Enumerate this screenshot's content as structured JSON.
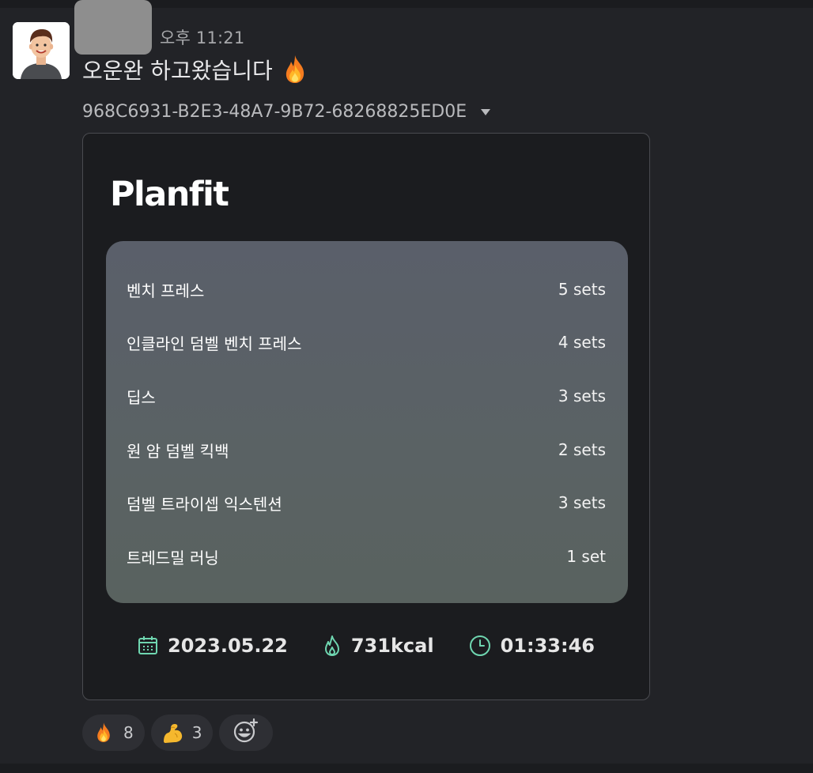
{
  "message": {
    "timestamp": "오후 11:21",
    "text": "오운완 하고왔습니다",
    "emoji": "fire"
  },
  "attachment": {
    "file_name": "968C6931-B2E3-48A7-9B72-68268825ED0E",
    "logo_text": "Planfit",
    "exercises": [
      {
        "name": "벤치 프레스",
        "sets": "5 sets"
      },
      {
        "name": "인클라인 덤벨 벤치 프레스",
        "sets": "4 sets"
      },
      {
        "name": "딥스",
        "sets": "3 sets"
      },
      {
        "name": "원 암 덤벨 킥백",
        "sets": "2 sets"
      },
      {
        "name": "덤벨 트라이셉 익스텐션",
        "sets": "3 sets"
      },
      {
        "name": "트레드밀 러닝",
        "sets": "1 set"
      }
    ],
    "stats": {
      "date": "2023.05.22",
      "calories": "731kcal",
      "duration": "01:33:46"
    }
  },
  "reactions": [
    {
      "emoji": "fire",
      "count": "8"
    },
    {
      "emoji": "flexed-biceps",
      "count": "3"
    }
  ],
  "colors": {
    "accent_green": "#6fd6b0",
    "background": "#222327",
    "card_top": "#5a5f6a",
    "card_bottom": "#59625f"
  }
}
